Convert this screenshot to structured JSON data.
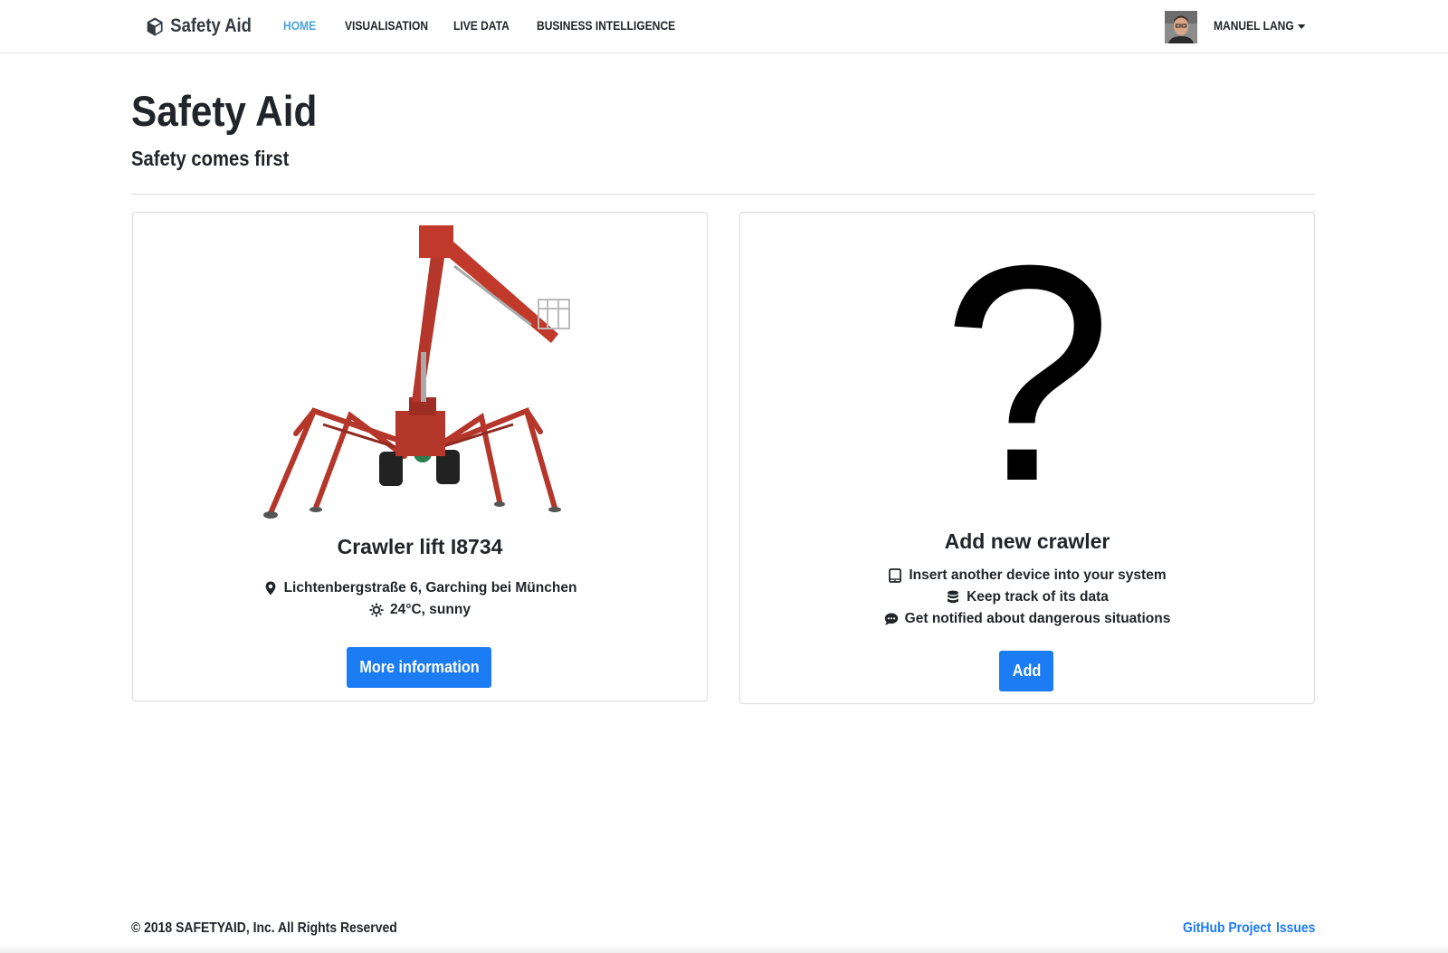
{
  "navbar": {
    "brand": "Safety Aid",
    "links": [
      {
        "label": "HOME",
        "active": true
      },
      {
        "label": "VISUALISATION",
        "active": false
      },
      {
        "label": "LIVE DATA",
        "active": false
      },
      {
        "label": "BUSINESS INTELLIGENCE",
        "active": false
      }
    ],
    "user_name": "MANUEL LANG",
    "icons": {
      "brand": "cube-icon",
      "menu": "caret-down-icon",
      "avatar": "user-avatar"
    }
  },
  "header": {
    "title": "Safety Aid",
    "subtitle": "Safety comes first"
  },
  "cards": {
    "crawler": {
      "title": "Crawler lift I8734",
      "location": "Lichtenbergstraße 6, Garching bei München",
      "weather": "24°C, sunny",
      "button": "More information",
      "icons": {
        "image": "crawler-lift-image",
        "location": "map-marker-icon",
        "weather": "sun-icon"
      }
    },
    "add": {
      "symbol": "?",
      "title": "Add new crawler",
      "features": [
        {
          "icon": "tablet-icon",
          "text": "Insert another device into your system"
        },
        {
          "icon": "database-icon",
          "text": "Keep track of its data"
        },
        {
          "icon": "comment-dots-icon",
          "text": "Get notified about dangerous situations"
        }
      ],
      "button": "Add"
    }
  },
  "footer": {
    "copyright": "© 2018 SAFETYAID, Inc. All Rights Reserved",
    "links": [
      "GitHub Project",
      "Issues"
    ]
  },
  "colors": {
    "accent": "#1c7cf4",
    "nav_active": "#4aa3df",
    "text": "#212529",
    "crane_red": "#c0392b"
  }
}
